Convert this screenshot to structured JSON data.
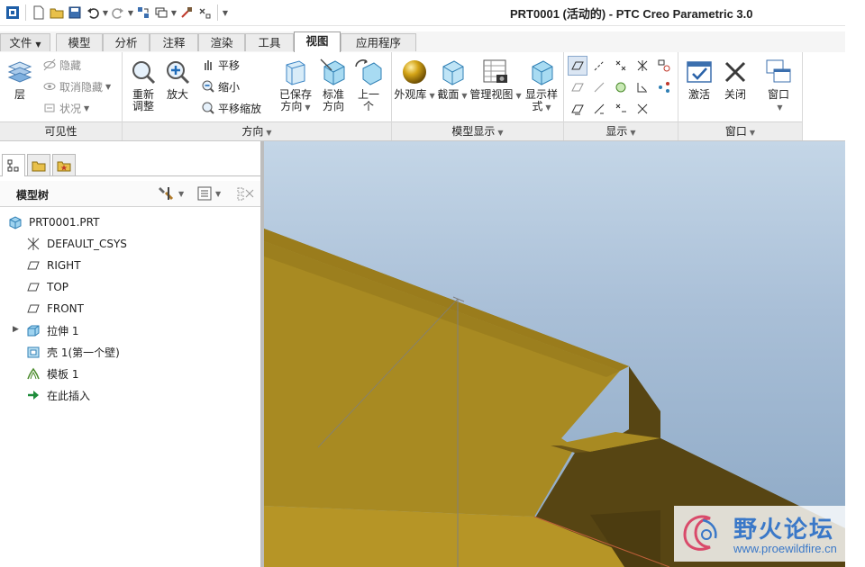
{
  "window": {
    "title": "PRT0001 (活动的) - PTC Creo Parametric 3.0"
  },
  "quick_access": {
    "icons": [
      "app-icon",
      "new-icon",
      "open-icon",
      "save-icon",
      "undo-icon",
      "redo-icon",
      "regenerate-icon",
      "windows-icon",
      "close-window-icon",
      "customize-icon"
    ]
  },
  "tabs": [
    {
      "label": "文件",
      "active": false
    },
    {
      "label": "模型",
      "active": false
    },
    {
      "label": "分析",
      "active": false
    },
    {
      "label": "注释",
      "active": false
    },
    {
      "label": "渲染",
      "active": false
    },
    {
      "label": "工具",
      "active": false
    },
    {
      "label": "视图",
      "active": true
    },
    {
      "label": "应用程序",
      "active": false
    }
  ],
  "ribbon": {
    "visibility": {
      "group_label": "可见性",
      "layer_label": "层",
      "hide_label": "隐藏",
      "unhide_label": "取消隐藏",
      "status_label": "状况"
    },
    "orientation": {
      "group_label": "方向",
      "refit_label_1": "重新",
      "refit_label_2": "调整",
      "zoom_in_label": "放大",
      "pan_label": "平移",
      "zoom_out_label": "缩小",
      "pan_zoom_label": "平移缩放",
      "saved_label_1": "已保存",
      "saved_label_2": "方向",
      "standard_label_1": "标准",
      "standard_label_2": "方向",
      "previous_label_1": "上一",
      "previous_label_2": "个"
    },
    "model_display": {
      "group_label": "模型显示",
      "appearance_label": "外观库",
      "section_label": "截面",
      "manage_views_label": "管理视图",
      "display_style_label_1": "显示样",
      "display_style_label_2": "式"
    },
    "show": {
      "group_label": "显示"
    },
    "window": {
      "group_label": "窗口",
      "activate_label": "激活",
      "close_label": "关闭",
      "windows_label": "窗口"
    }
  },
  "model_tree": {
    "header": "模型树",
    "items": [
      {
        "label": "PRT0001.PRT",
        "icon": "part-icon"
      },
      {
        "label": "DEFAULT_CSYS",
        "icon": "csys-icon"
      },
      {
        "label": "RIGHT",
        "icon": "datum-plane-icon"
      },
      {
        "label": "TOP",
        "icon": "datum-plane-icon"
      },
      {
        "label": "FRONT",
        "icon": "datum-plane-icon"
      },
      {
        "label": "拉伸 1",
        "icon": "extrude-icon"
      },
      {
        "label": "壳 1(第一个壁)",
        "icon": "shell-icon"
      },
      {
        "label": "模板 1",
        "icon": "template-icon"
      },
      {
        "label": "在此插入",
        "icon": "insert-here-icon"
      }
    ]
  },
  "colors": {
    "model_top": "#a88a22",
    "model_dark": "#574513",
    "background_top": "#c4d6e7",
    "background_bottom": "#8ba7c4"
  },
  "watermark": {
    "text_cn": "野火论坛",
    "url": "www.proewildfire.cn"
  }
}
